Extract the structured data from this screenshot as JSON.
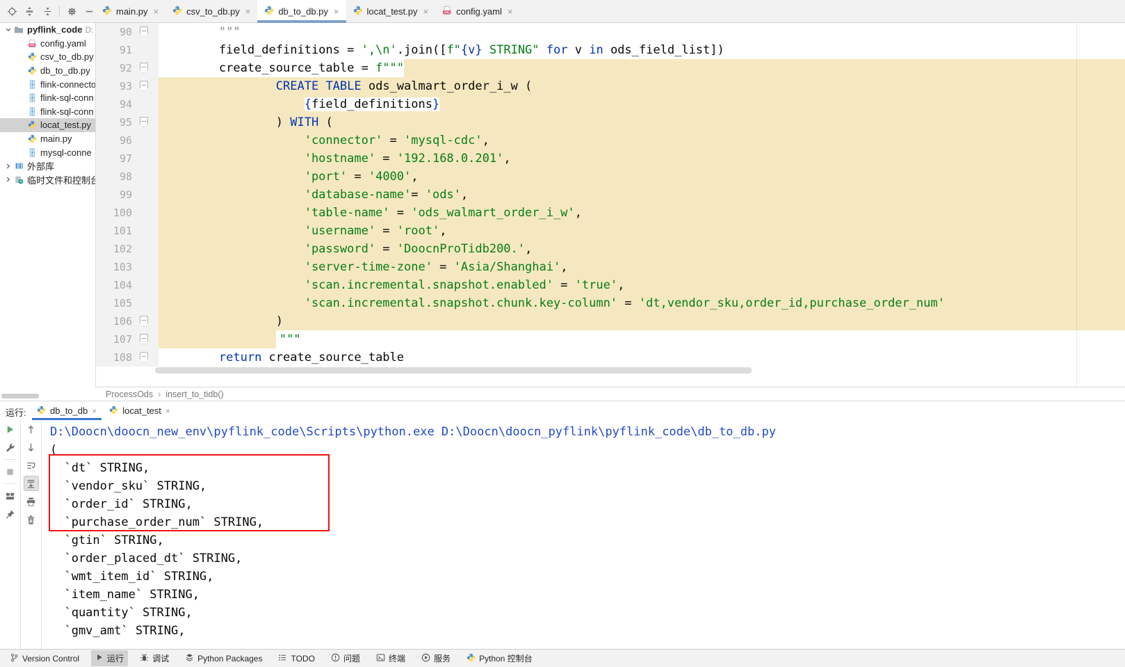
{
  "project_toolbar": {
    "icons": [
      "locate-icon",
      "expand-all-icon",
      "collapse-all-icon",
      "separator",
      "gear-icon",
      "hide-panel-icon"
    ]
  },
  "editor_tabs": [
    {
      "label": "main.py",
      "icon": "python",
      "active": false
    },
    {
      "label": "csv_to_db.py",
      "icon": "python",
      "active": false
    },
    {
      "label": "db_to_db.py",
      "icon": "python",
      "active": true
    },
    {
      "label": "locat_test.py",
      "icon": "python",
      "active": false
    },
    {
      "label": "config.yaml",
      "icon": "yaml",
      "active": false
    }
  ],
  "close_glyph": "×",
  "project_tree": {
    "root": {
      "label": "pyflink_code",
      "path_hint": "D:",
      "icon": "folder"
    },
    "children": [
      {
        "label": "config.yaml",
        "icon": "yaml",
        "selected": false
      },
      {
        "label": "csv_to_db.py",
        "icon": "python",
        "selected": false
      },
      {
        "label": "db_to_db.py",
        "icon": "python",
        "selected": false
      },
      {
        "label": "flink-connecto",
        "icon": "archive",
        "selected": false
      },
      {
        "label": "flink-sql-conn",
        "icon": "archive",
        "selected": false
      },
      {
        "label": "flink-sql-conn",
        "icon": "archive",
        "selected": false
      },
      {
        "label": "locat_test.py",
        "icon": "python",
        "selected": true
      },
      {
        "label": "main.py",
        "icon": "python",
        "selected": false
      },
      {
        "label": "mysql-conne",
        "icon": "archive",
        "selected": false
      }
    ],
    "bottom_items": [
      {
        "label": "外部库",
        "icon": "libraries"
      },
      {
        "label": "临时文件和控制台",
        "icon": "scratches"
      }
    ]
  },
  "editor": {
    "breadcrumb": [
      "ProcessOds",
      "insert_to_tidb()"
    ],
    "code_lines": [
      {
        "num": 90,
        "fold": true,
        "indent": 8,
        "hl": "none",
        "segs": [
          {
            "t": "\"\"\"",
            "c": "doc"
          }
        ]
      },
      {
        "num": 91,
        "fold": false,
        "indent": 8,
        "hl": "none",
        "segs": [
          {
            "t": "field_definitions = ",
            "c": "plain"
          },
          {
            "t": "',\\n'",
            "c": "str"
          },
          {
            "t": ".join([",
            "c": "plain"
          },
          {
            "t": "f\"",
            "c": "str"
          },
          {
            "t": "{v}",
            "c": "brace"
          },
          {
            "t": " STRING\"",
            "c": "str"
          },
          {
            "t": " ",
            "c": "plain"
          },
          {
            "t": "for",
            "c": "kw"
          },
          {
            "t": " v ",
            "c": "plain"
          },
          {
            "t": "in",
            "c": "kw"
          },
          {
            "t": " ods_field_list])",
            "c": "plain"
          }
        ]
      },
      {
        "num": 92,
        "fold": true,
        "indent": 8,
        "hl": "after",
        "segs": [
          {
            "t": "create_source_table = ",
            "c": "plain"
          },
          {
            "t": "f\"\"\"",
            "c": "str"
          }
        ]
      },
      {
        "num": 93,
        "fold": true,
        "indent": 16,
        "hl": "full",
        "segs": [
          {
            "t": "CREATE",
            "c": "kw"
          },
          {
            "t": " ",
            "c": "plain"
          },
          {
            "t": "TABLE",
            "c": "kw"
          },
          {
            "t": " ods_walmart_order_i_w (",
            "c": "plain"
          }
        ]
      },
      {
        "num": 94,
        "fold": false,
        "indent": 20,
        "hl": "full",
        "patch": true,
        "segs": [
          {
            "t": "{",
            "c": "brace"
          },
          {
            "t": "field_definitions",
            "c": "plain"
          },
          {
            "t": "}",
            "c": "brace"
          }
        ]
      },
      {
        "num": 95,
        "fold": true,
        "indent": 16,
        "hl": "full",
        "segs": [
          {
            "t": ") ",
            "c": "plain"
          },
          {
            "t": "WITH",
            "c": "kw"
          },
          {
            "t": " (",
            "c": "plain"
          }
        ]
      },
      {
        "num": 96,
        "fold": false,
        "indent": 20,
        "hl": "full",
        "segs": [
          {
            "t": "'connector'",
            "c": "str"
          },
          {
            "t": " = ",
            "c": "plain"
          },
          {
            "t": "'mysql-cdc'",
            "c": "str"
          },
          {
            "t": ",",
            "c": "plain"
          }
        ]
      },
      {
        "num": 97,
        "fold": false,
        "indent": 20,
        "hl": "full",
        "segs": [
          {
            "t": "'hostname'",
            "c": "str"
          },
          {
            "t": " = ",
            "c": "plain"
          },
          {
            "t": "'192.168.0.201'",
            "c": "str"
          },
          {
            "t": ",",
            "c": "plain"
          }
        ]
      },
      {
        "num": 98,
        "fold": false,
        "indent": 20,
        "hl": "full",
        "segs": [
          {
            "t": "'port'",
            "c": "str"
          },
          {
            "t": " = ",
            "c": "plain"
          },
          {
            "t": "'4000'",
            "c": "str"
          },
          {
            "t": ",",
            "c": "plain"
          }
        ]
      },
      {
        "num": 99,
        "fold": false,
        "indent": 20,
        "hl": "full",
        "segs": [
          {
            "t": "'database-name'",
            "c": "str"
          },
          {
            "t": "= ",
            "c": "plain"
          },
          {
            "t": "'ods'",
            "c": "str"
          },
          {
            "t": ",",
            "c": "plain"
          }
        ]
      },
      {
        "num": 100,
        "fold": false,
        "indent": 20,
        "hl": "full",
        "segs": [
          {
            "t": "'table-name'",
            "c": "str"
          },
          {
            "t": " = ",
            "c": "plain"
          },
          {
            "t": "'ods_walmart_order_i_w'",
            "c": "str"
          },
          {
            "t": ",",
            "c": "plain"
          }
        ]
      },
      {
        "num": 101,
        "fold": false,
        "indent": 20,
        "hl": "full",
        "segs": [
          {
            "t": "'username'",
            "c": "str"
          },
          {
            "t": " = ",
            "c": "plain"
          },
          {
            "t": "'root'",
            "c": "str"
          },
          {
            "t": ",",
            "c": "plain"
          }
        ]
      },
      {
        "num": 102,
        "fold": false,
        "indent": 20,
        "hl": "full",
        "segs": [
          {
            "t": "'password'",
            "c": "str"
          },
          {
            "t": " = ",
            "c": "plain"
          },
          {
            "t": "'DoocnProTidb200.'",
            "c": "str"
          },
          {
            "t": ",",
            "c": "plain"
          }
        ]
      },
      {
        "num": 103,
        "fold": false,
        "indent": 20,
        "hl": "full",
        "segs": [
          {
            "t": "'server-time-zone'",
            "c": "str"
          },
          {
            "t": " = ",
            "c": "plain"
          },
          {
            "t": "'Asia/Shanghai'",
            "c": "str"
          },
          {
            "t": ",",
            "c": "plain"
          }
        ]
      },
      {
        "num": 104,
        "fold": false,
        "indent": 20,
        "hl": "full",
        "segs": [
          {
            "t": "'scan.incremental.snapshot.enabled'",
            "c": "str"
          },
          {
            "t": " = ",
            "c": "plain"
          },
          {
            "t": "'true'",
            "c": "str"
          },
          {
            "t": ",",
            "c": "plain"
          }
        ]
      },
      {
        "num": 105,
        "fold": false,
        "indent": 20,
        "hl": "full",
        "segs": [
          {
            "t": "'scan.incremental.snapshot.chunk.key-column'",
            "c": "str"
          },
          {
            "t": " = ",
            "c": "plain"
          },
          {
            "t": "'dt,vendor_sku,order_id,purchase_order_num'",
            "c": "str"
          }
        ]
      },
      {
        "num": 106,
        "fold": true,
        "indent": 16,
        "hl": "full",
        "segs": [
          {
            "t": ")",
            "c": "plain"
          }
        ]
      },
      {
        "num": 107,
        "fold": true,
        "indent": 16,
        "hl": "left",
        "segs": [
          {
            "t": "\"\"\"",
            "c": "str"
          }
        ]
      },
      {
        "num": 108,
        "fold": true,
        "indent": 8,
        "hl": "none",
        "segs": [
          {
            "t": "return",
            "c": "kw"
          },
          {
            "t": " create_source_table",
            "c": "plain"
          }
        ]
      }
    ]
  },
  "run_panel": {
    "label": "运行:",
    "tabs": [
      {
        "label": "db_to_db",
        "active": true
      },
      {
        "label": "locat_test",
        "active": false
      }
    ],
    "toolbar_col1": [
      {
        "icon": "rerun-play-icon"
      },
      {
        "icon": "wrench-icon"
      },
      {
        "sep": true
      },
      {
        "icon": "stop-icon"
      },
      {
        "sep": true
      },
      {
        "icon": "restore-layout-icon"
      },
      {
        "icon": "pin-icon"
      }
    ],
    "toolbar_col2": [
      {
        "icon": "arrow-up-icon"
      },
      {
        "icon": "arrow-down-icon"
      },
      {
        "icon": "soft-wrap-icon"
      },
      {
        "icon": "scroll-to-end-icon",
        "selected": true
      },
      {
        "icon": "printer-icon"
      },
      {
        "icon": "trash-icon"
      }
    ],
    "console_lines": [
      {
        "text": "D:\\Doocn\\doocn_new_env\\pyflink_code\\Scripts\\python.exe D:\\Doocn\\doocn_pyflink\\pyflink_code\\db_to_db.py",
        "type": "path"
      },
      {
        "text": "(",
        "type": "out"
      },
      {
        "text": "  `dt` STRING,",
        "type": "out"
      },
      {
        "text": "  `vendor_sku` STRING,",
        "type": "out"
      },
      {
        "text": "  `order_id` STRING,",
        "type": "out"
      },
      {
        "text": "  `purchase_order_num` STRING,",
        "type": "out"
      },
      {
        "text": "  `gtin` STRING,",
        "type": "out"
      },
      {
        "text": "  `order_placed_dt` STRING,",
        "type": "out"
      },
      {
        "text": "  `wmt_item_id` STRING,",
        "type": "out"
      },
      {
        "text": "  `item_name` STRING,",
        "type": "out"
      },
      {
        "text": "  `quantity` STRING,",
        "type": "out"
      },
      {
        "text": "  `gmv_amt` STRING,",
        "type": "out"
      }
    ]
  },
  "status_bar": {
    "items": [
      {
        "label": "Version Control",
        "icon": "branch-icon",
        "selected": false
      },
      {
        "label": "运行",
        "icon": "play-icon",
        "selected": true
      },
      {
        "label": "调试",
        "icon": "bug-icon",
        "selected": false
      },
      {
        "label": "Python Packages",
        "icon": "packages-icon",
        "selected": false
      },
      {
        "label": "TODO",
        "icon": "todo-icon",
        "selected": false
      },
      {
        "label": "问题",
        "icon": "problems-icon",
        "selected": false
      },
      {
        "label": "终端",
        "icon": "terminal-icon",
        "selected": false
      },
      {
        "label": "服务",
        "icon": "services-icon",
        "selected": false
      },
      {
        "label": "Python 控制台",
        "icon": "python-icon",
        "selected": false
      }
    ]
  },
  "colors": {
    "highlight_yellow": "#f5e8c0",
    "keyword_blue": "#0033b3",
    "string_green": "#067d17",
    "console_path_blue": "#2149c9",
    "red_box": "#ee1211",
    "editor_tab_underline": "#7da3c8",
    "run_tab_underline": "#3876d2"
  }
}
